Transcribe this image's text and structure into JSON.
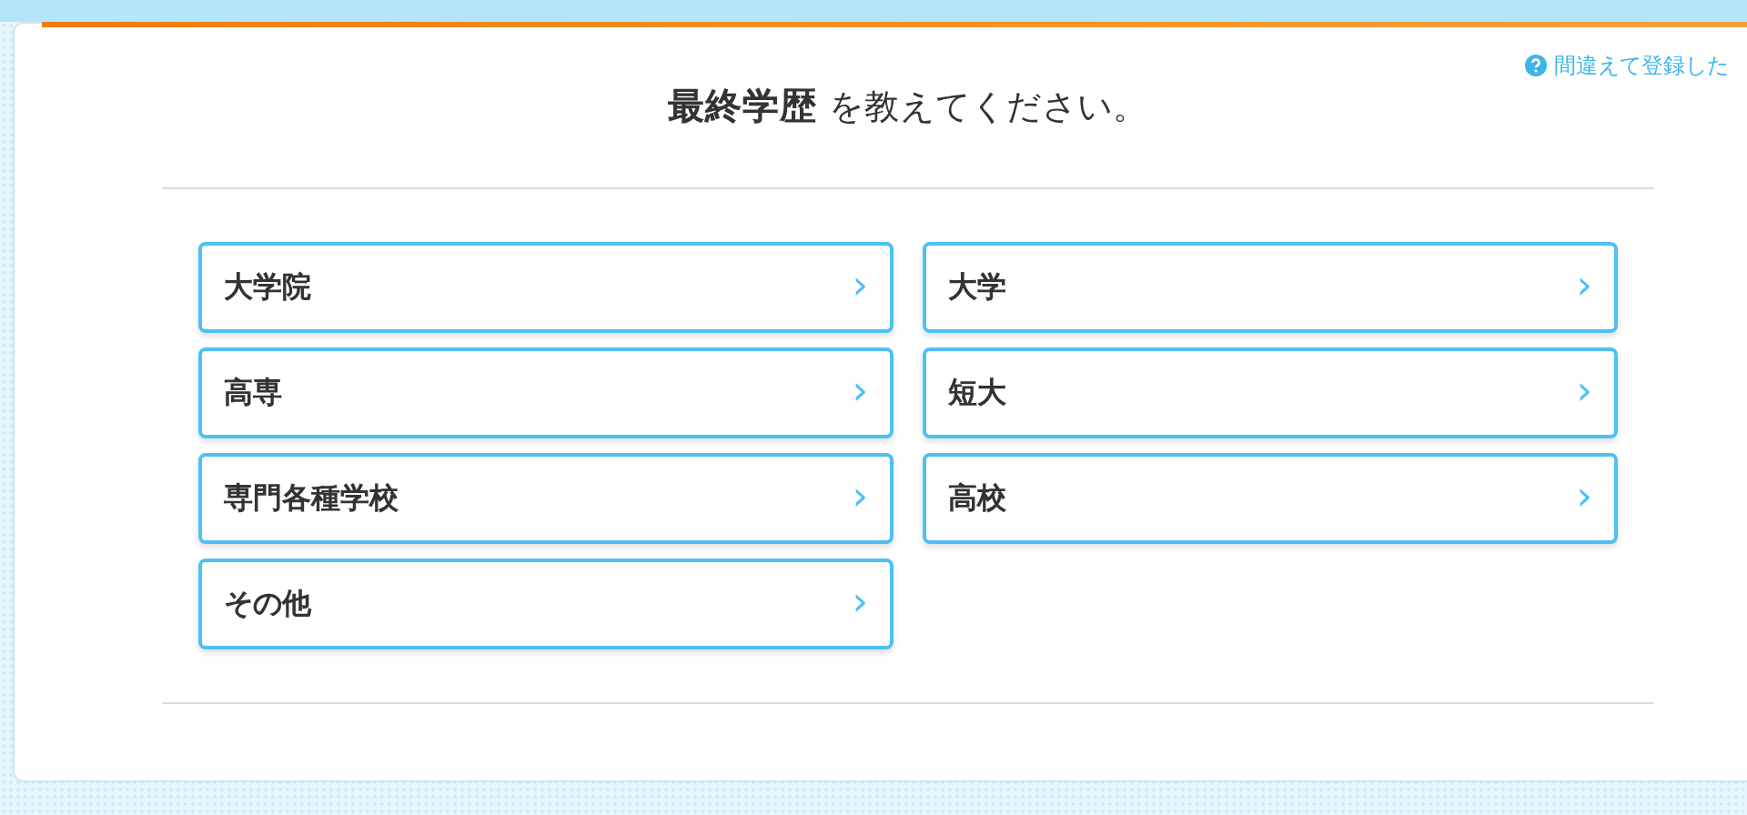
{
  "help_link": {
    "text": "間違えて登録した"
  },
  "question": {
    "title": "**最終学歴** を教えてください。"
  },
  "options": [
    {
      "label": "大学院",
      "chevron": "›"
    },
    {
      "label": "大学",
      "chevron": "›"
    },
    {
      "label": "高専",
      "chevron": "›"
    },
    {
      "label": "短大",
      "chevron": "›"
    },
    {
      "label": "専門各種学校",
      "chevron": "›"
    },
    {
      "label": "高校",
      "chevron": "›"
    },
    {
      "label": "その他",
      "chevron": "›"
    }
  ]
}
